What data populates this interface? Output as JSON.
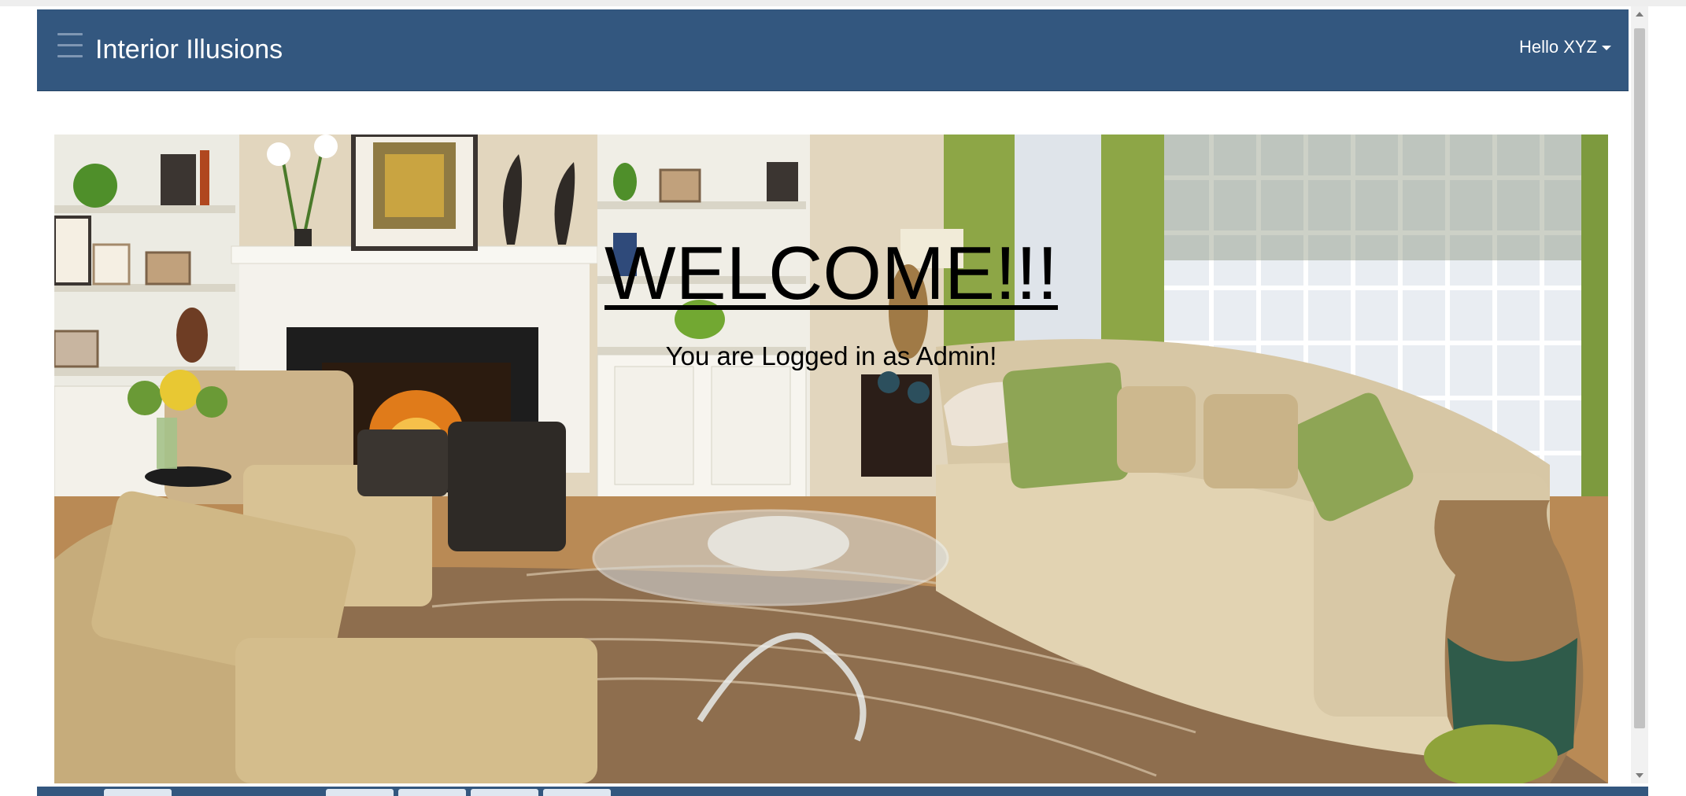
{
  "navbar": {
    "brand": "Interior Illusions",
    "user_greeting": "Hello XYZ",
    "menu_icon": "hamburger-menu-icon"
  },
  "hero": {
    "welcome": "WELCOME!!!",
    "subtitle": "You are Logged in as Admin!",
    "image": "living-room-interior-photo"
  },
  "colors": {
    "navbar_bg": "#33577f",
    "text": "#000000",
    "navbar_text": "#ffffff"
  }
}
